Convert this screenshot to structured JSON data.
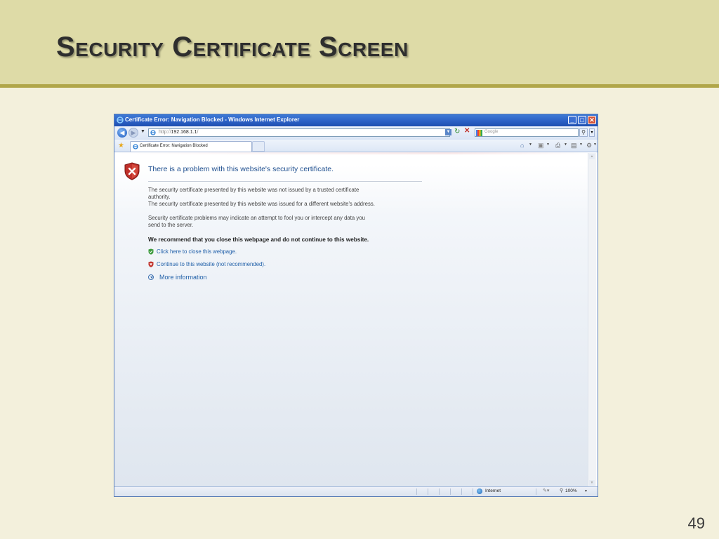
{
  "slide": {
    "title": "Security Certificate Screen",
    "page_number": "49"
  },
  "browser": {
    "window_title": "Certificate Error: Navigation Blocked - Windows Internet Explorer",
    "controls": {
      "minimize": "_",
      "maximize": "□",
      "close": "✕"
    },
    "address": {
      "prefix": "http://",
      "host": "192.168.1.1",
      "suffix": "/"
    },
    "search_placeholder": "Google",
    "tab_title": "Certificate Error: Navigation Blocked",
    "icons": [
      "back-icon",
      "forward-icon",
      "refresh-icon",
      "stop-icon",
      "search-icon",
      "favorites-star-icon",
      "home-icon",
      "feeds-icon",
      "print-icon",
      "page-menu-icon",
      "tools-menu-icon",
      "globe-icon",
      "zoom-icon"
    ]
  },
  "page": {
    "heading": "There is a problem with this website's security certificate.",
    "para1_line1": "The security certificate presented by this website was not issued by a trusted certificate",
    "para1_line2": "authority.",
    "para1_line3": "The security certificate presented by this website was issued for a different website's address.",
    "para2_line1": "Security certificate problems may indicate an attempt to fool you or intercept any data you",
    "para2_line2": "send to the server.",
    "recommendation": "We recommend that you close this webpage and do not continue to this website.",
    "close_link": "Click here to close this webpage.",
    "continue_link": "Continue to this website (not recommended).",
    "more_info": "More information"
  },
  "statusbar": {
    "zone": "Internet",
    "zoom": "100%"
  },
  "colors": {
    "slide_background": "#f3f0dc",
    "header_band": "#dedba7",
    "header_rule": "#b0a649",
    "link": "#1f5fa8",
    "heading": "#1f4f8f",
    "error_red": "#c0302a"
  }
}
